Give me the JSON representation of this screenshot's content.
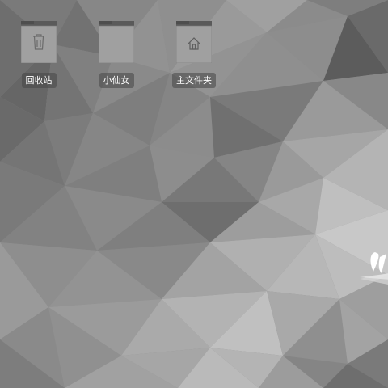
{
  "desktop": {
    "icons": [
      {
        "label": "回收站",
        "icon": "trash-icon"
      },
      {
        "label": "小仙女",
        "icon": "folder-icon"
      },
      {
        "label": "主文件夹",
        "icon": "home-icon"
      }
    ]
  },
  "colors": {
    "wallpaper_base": "#8a8a8a",
    "folder_body": "#9c9c9c",
    "folder_tab": "#5e5e5e",
    "label_bg": "#4a4a4a",
    "label_text": "#ffffff"
  }
}
